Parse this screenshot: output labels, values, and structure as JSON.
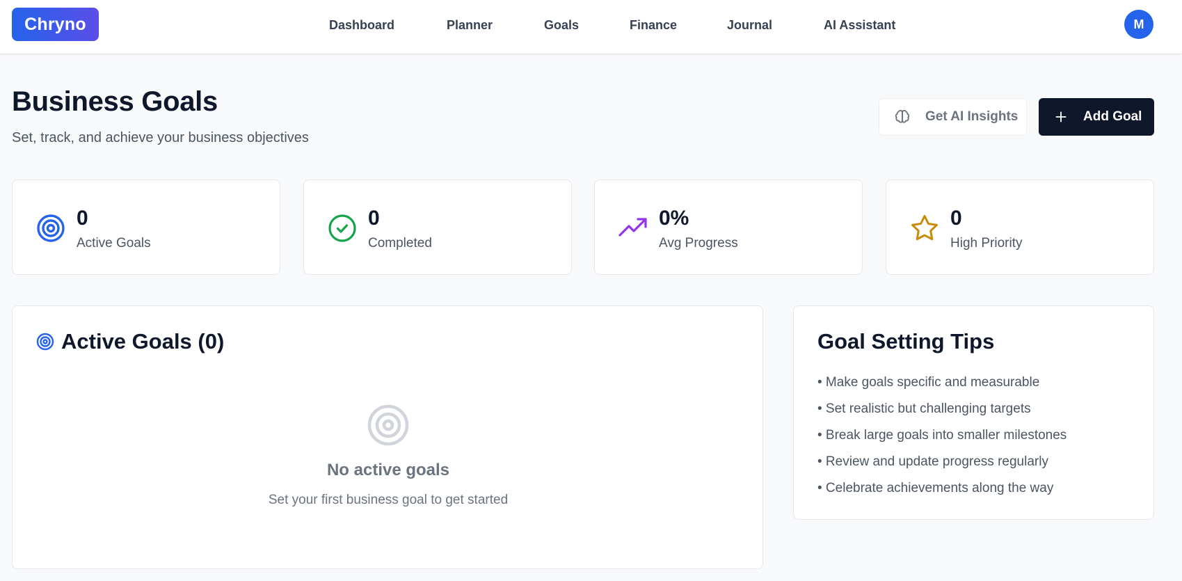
{
  "header": {
    "logo": "Chryno",
    "nav": [
      {
        "label": "Dashboard"
      },
      {
        "label": "Planner"
      },
      {
        "label": "Goals"
      },
      {
        "label": "Finance"
      },
      {
        "label": "Journal"
      },
      {
        "label": "AI Assistant"
      }
    ],
    "avatar_initial": "M"
  },
  "page": {
    "title": "Business Goals",
    "subtitle": "Set, track, and achieve your business objectives",
    "ai_button": "Get AI Insights",
    "add_button": "Add Goal"
  },
  "stats": [
    {
      "value": "0",
      "label": "Active Goals",
      "icon": "target-icon",
      "color": "#2563eb"
    },
    {
      "value": "0",
      "label": "Completed",
      "icon": "check-circle-icon",
      "color": "#16a34a"
    },
    {
      "value": "0%",
      "label": "Avg Progress",
      "icon": "trending-up-icon",
      "color": "#9333ea"
    },
    {
      "value": "0",
      "label": "High Priority",
      "icon": "star-icon",
      "color": "#ca8a04"
    }
  ],
  "active_goals": {
    "title": "Active Goals (0)",
    "empty_title": "No active goals",
    "empty_text": "Set your first business goal to get started"
  },
  "tips": {
    "title": "Goal Setting Tips",
    "items": [
      "• Make goals specific and measurable",
      "• Set realistic but challenging targets",
      "• Break large goals into smaller milestones",
      "• Review and update progress regularly",
      "• Celebrate achievements along the way"
    ]
  }
}
